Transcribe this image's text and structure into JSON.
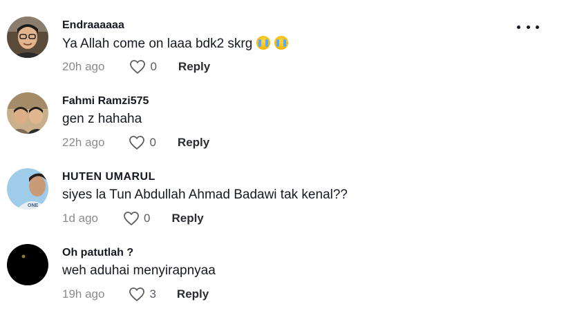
{
  "comments": [
    {
      "username": "Endraaaaaa",
      "text": "Ya Allah come on laaa bdk2 skrg",
      "emojis": [
        "crying-face-emoji",
        "crying-face-emoji"
      ],
      "time": "20h ago",
      "likes": "0",
      "reply_label": "Reply"
    },
    {
      "username": "Fahmi Ramzi575",
      "text": "gen z hahaha",
      "time": "22h ago",
      "likes": "0",
      "reply_label": "Reply"
    },
    {
      "username": "HUTEN UMARUL",
      "text": "siyes la Tun Abdullah Ahmad Badawi tak kenal??",
      "time": "1d ago",
      "likes": "0",
      "reply_label": "Reply"
    },
    {
      "username": "Oh patutlah ?",
      "text": "weh aduhai menyirapnyaa",
      "time": "19h ago",
      "likes": "3",
      "reply_label": "Reply"
    }
  ],
  "more_icon": "more-horizontal-icon",
  "colors": {
    "primary_text": "#161823",
    "secondary_text": "#8a8b91",
    "heart_outline": "#5c5d63"
  }
}
